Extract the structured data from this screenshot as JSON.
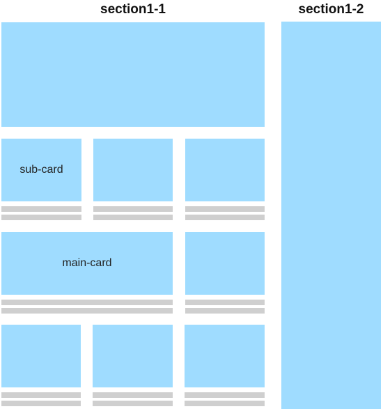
{
  "colors": {
    "box": "#9fdcff",
    "placeholder_line": "#cfcfcf",
    "heading_text": "#111111",
    "label_text": "#222222"
  },
  "section1_1": {
    "title": "section1-1",
    "sub_card_label": "sub-card",
    "main_card_label": "main-card"
  },
  "section1_2": {
    "title": "section1-2"
  }
}
